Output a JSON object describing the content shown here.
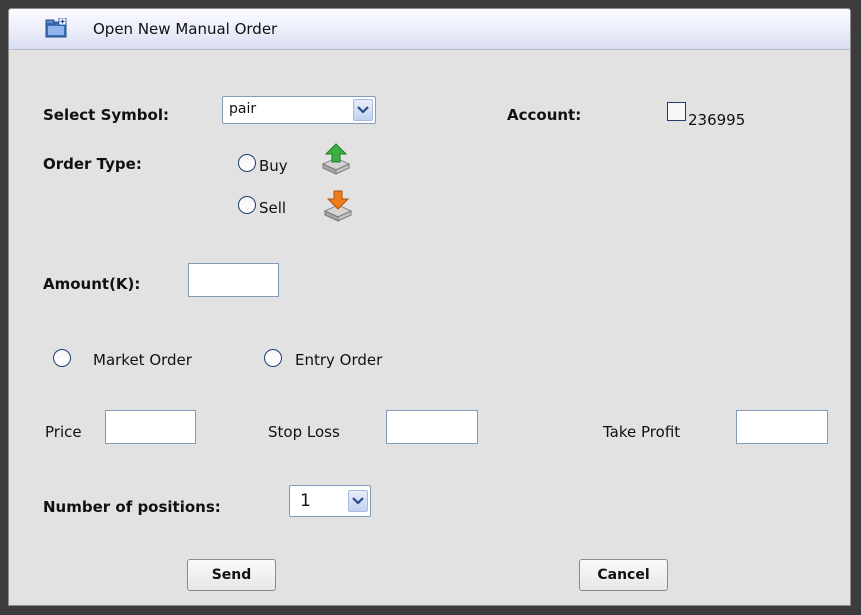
{
  "dialog": {
    "title": "Open New Manual Order",
    "icon": "folder-add-icon"
  },
  "form": {
    "select_symbol_label": "Select Symbol:",
    "symbol_value": "pair",
    "account_label": "Account:",
    "account_number": "236995",
    "order_type_label": "Order Type:",
    "buy_label": "Buy",
    "sell_label": "Sell",
    "amount_label": "Amount(K):",
    "amount_value": "",
    "market_order_label": "Market Order",
    "entry_order_label": "Entry Order",
    "price_label": "Price",
    "stop_loss_label": "Stop Loss",
    "take_profit_label": "Take Profit",
    "positions_label": "Number of positions:",
    "positions_value": "1"
  },
  "buttons": {
    "send_label": "Send",
    "cancel_label": "Cancel"
  },
  "colors": {
    "buy_arrow": "#3cb043",
    "sell_arrow": "#f07c1a",
    "titlebar": "#e4e7f6"
  }
}
